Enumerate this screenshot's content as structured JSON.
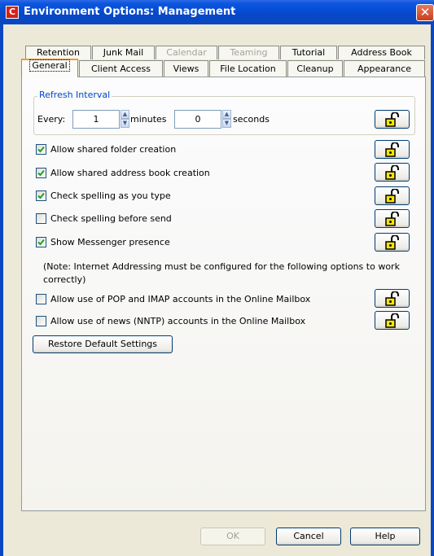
{
  "window": {
    "title": "Environment Options:  Management",
    "icon_letter": "C",
    "close_glyph": "✕"
  },
  "tabs_back": [
    {
      "label": "Retention",
      "disabled": false
    },
    {
      "label": "Junk Mail",
      "disabled": false
    },
    {
      "label": "Calendar",
      "disabled": true
    },
    {
      "label": "Teaming",
      "disabled": true
    },
    {
      "label": "Tutorial",
      "disabled": false
    },
    {
      "label": "Address Book",
      "disabled": false
    }
  ],
  "tabs_front": [
    {
      "label": "General",
      "active": true
    },
    {
      "label": "Client Access"
    },
    {
      "label": "Views"
    },
    {
      "label": "File Location"
    },
    {
      "label": "Cleanup"
    },
    {
      "label": "Appearance"
    }
  ],
  "refresh": {
    "group_title": "Refresh Interval",
    "every_label": "Every:",
    "minutes_value": "1",
    "minutes_label": "minutes",
    "seconds_value": "0",
    "seconds_label": "seconds"
  },
  "options": [
    {
      "label": "Allow shared folder creation",
      "checked": true
    },
    {
      "label": "Allow shared address book creation",
      "checked": true
    },
    {
      "label": "Check spelling as you type",
      "checked": true
    },
    {
      "label": "Check spelling before send",
      "checked": false
    },
    {
      "label": "Show Messenger presence",
      "checked": true
    }
  ],
  "note": "(Note: Internet Addressing must be configured for the following options to work correctly)",
  "internet_options": [
    {
      "label": "Allow use of POP and IMAP accounts in the Online Mailbox",
      "checked": false
    },
    {
      "label": "Allow use of news (NNTP) accounts in the Online Mailbox",
      "checked": false
    }
  ],
  "buttons": {
    "restore": "Restore Default Settings",
    "ok": "OK",
    "cancel": "Cancel",
    "help": "Help"
  },
  "icons": {
    "lock": "unlock-icon",
    "check": "check-icon"
  },
  "colors": {
    "titlebar": "#0747c8",
    "group_title": "#0046d5",
    "lock_yellow": "#f7e600"
  }
}
